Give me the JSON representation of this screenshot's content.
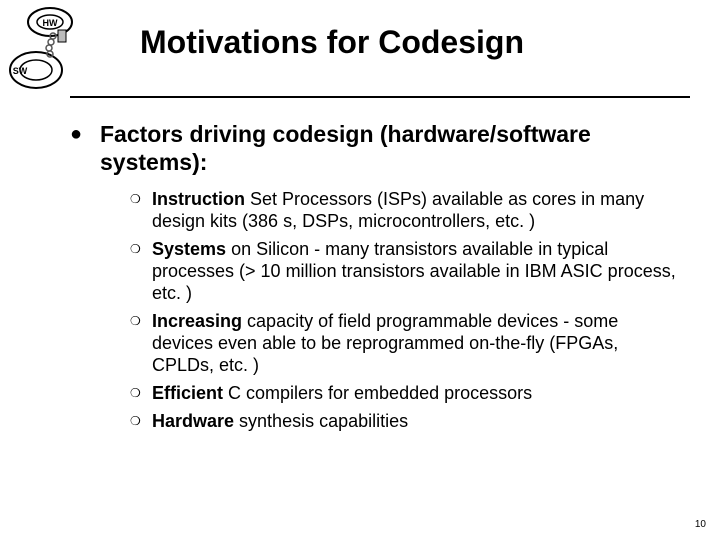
{
  "logo": {
    "hw": "HW",
    "sw": "SW"
  },
  "title": "Motivations for Codesign",
  "main": {
    "heading": "Factors driving codesign (hardware/software systems):",
    "bullets": [
      {
        "lead": "Instruction",
        "rest": " Set Processors (ISPs) available as cores in many design kits (386 s, DSPs, microcontrollers, etc. )"
      },
      {
        "lead": "Systems",
        "rest": " on Silicon - many transistors available in typical processes (> 10 million transistors available in IBM ASIC process, etc. )"
      },
      {
        "lead": "Increasing",
        "rest": " capacity of field programmable devices - some devices even able to be reprogrammed on-the-fly (FPGAs, CPLDs, etc. )"
      },
      {
        "lead": "Efficient",
        "rest": " C compilers for embedded processors"
      },
      {
        "lead": "Hardware",
        "rest": " synthesis capabilities"
      }
    ]
  },
  "page_number": "10"
}
